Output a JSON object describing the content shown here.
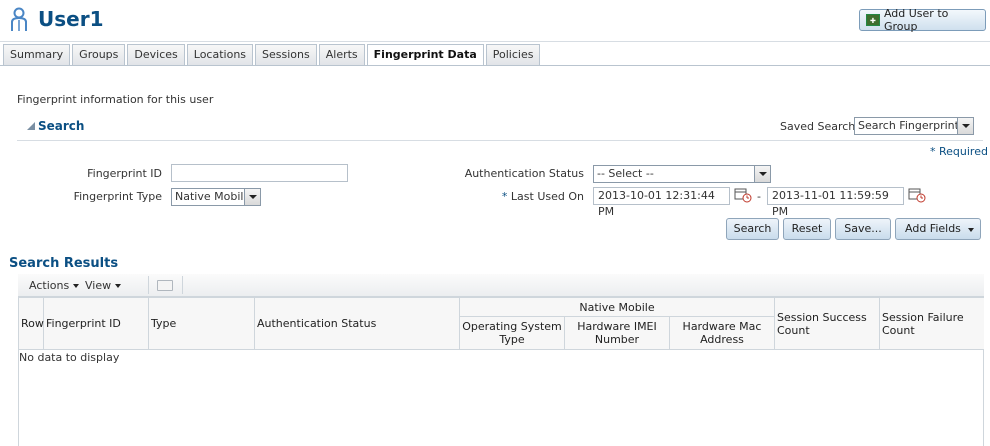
{
  "header": {
    "title": "User1",
    "add_group_label": "Add User to Group"
  },
  "tabs": [
    {
      "label": "Summary"
    },
    {
      "label": "Groups"
    },
    {
      "label": "Devices"
    },
    {
      "label": "Locations"
    },
    {
      "label": "Sessions"
    },
    {
      "label": "Alerts"
    },
    {
      "label": "Fingerprint Data",
      "active": true
    },
    {
      "label": "Policies"
    }
  ],
  "info_text": "Fingerprint information for this user",
  "search": {
    "title": "Search",
    "saved_search_label": "Saved Search",
    "saved_search_value": "Search Fingerprints",
    "required_label": "Required",
    "fields": {
      "fingerprint_id_label": "Fingerprint ID",
      "fingerprint_id_value": "",
      "fingerprint_type_label": "Fingerprint Type",
      "fingerprint_type_value": "Native Mobile",
      "auth_status_label": "Authentication Status",
      "auth_status_value": "-- Select --",
      "last_used_label": "Last Used On",
      "last_used_from": "2013-10-01 12:31:44 PM",
      "last_used_to": "2013-11-01 11:59:59 PM",
      "range_sep": "-"
    },
    "buttons": {
      "search": "Search",
      "reset": "Reset",
      "save": "Save...",
      "add_fields": "Add Fields"
    }
  },
  "results": {
    "title": "Search Results",
    "toolbar": {
      "actions": "Actions",
      "view": "View"
    },
    "columns": {
      "row": "Row",
      "fingerprint_id": "Fingerprint ID",
      "type": "Type",
      "auth_status": "Authentication Status",
      "native_mobile": "Native Mobile",
      "os_type": "Operating System Type",
      "imei": "Hardware IMEI Number",
      "mac": "Hardware Mac Address",
      "success_count": "Session Success Count",
      "failure_count": "Session Failure Count"
    },
    "empty_text": "No data to display"
  },
  "colors": {
    "title_blue": "#0b4f83",
    "button_gradient_top": "#eef4fa",
    "button_gradient_bottom": "#c9dcec",
    "border": "#cfd6dc"
  }
}
